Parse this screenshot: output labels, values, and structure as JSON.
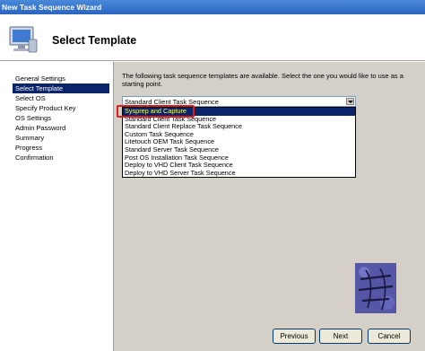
{
  "window": {
    "title": "New Task Sequence Wizard",
    "icon": "computer-monitor-icon"
  },
  "header": {
    "title": "Select Template"
  },
  "sidebar": {
    "items": [
      {
        "label": "General Settings",
        "selected": false
      },
      {
        "label": "Select Template",
        "selected": true
      },
      {
        "label": "Select OS",
        "selected": false
      },
      {
        "label": "Specify Product Key",
        "selected": false
      },
      {
        "label": "OS Settings",
        "selected": false
      },
      {
        "label": "Admin Password",
        "selected": false
      },
      {
        "label": "Summary",
        "selected": false
      },
      {
        "label": "Progress",
        "selected": false
      },
      {
        "label": "Confirmation",
        "selected": false
      }
    ]
  },
  "main": {
    "intro_text": "The following task sequence templates are available.  Select the one you would like to use as a starting point.",
    "template_select": {
      "selected_value": "Standard Client Task Sequence",
      "highlighted_option": "Sysprep and Capture",
      "options": [
        "Sysprep and Capture",
        "Standard Client Task Sequence",
        "Standard Client Replace Task Sequence",
        "Custom Task Sequence",
        "Litetouch OEM Task Sequence",
        "Standard Server Task Sequence",
        "Post OS Installation Task Sequence",
        "Deploy to VHD Client Task Sequence",
        "Deploy to VHD Server Task Sequence"
      ]
    },
    "callout_color": "#e01b1b",
    "watermark_logo": "tech-news-logo"
  },
  "buttons": {
    "previous": "Previous",
    "next": "Next",
    "cancel": "Cancel"
  },
  "colors": {
    "selection": "#0a246a",
    "highlight_text": "#ffff66",
    "titlebar": "#2a64c0"
  }
}
